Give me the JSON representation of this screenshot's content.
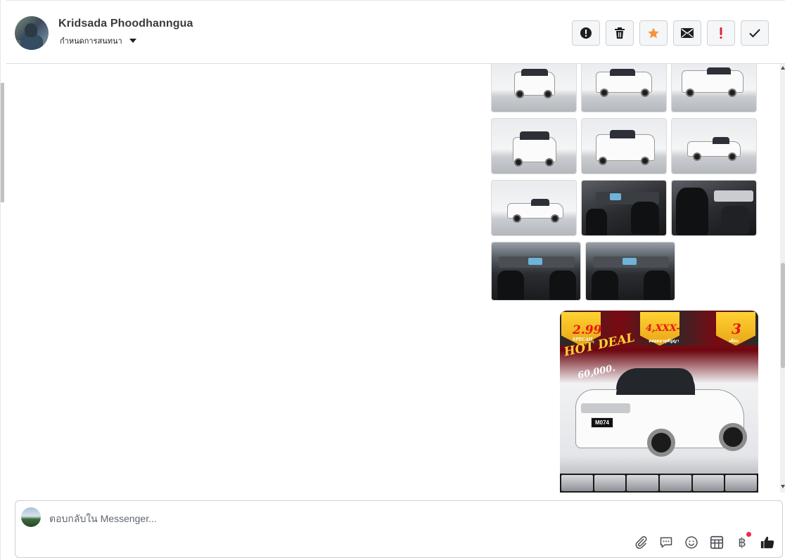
{
  "header": {
    "user_name": "Kridsada Phoodhanngua",
    "subtitle": "กำหนดการสนทนา",
    "actions": [
      {
        "name": "report-icon",
        "color": "#1c1e21"
      },
      {
        "name": "trash-icon",
        "color": "#1c1e21"
      },
      {
        "name": "star-icon",
        "color": "#f7923b"
      },
      {
        "name": "envelope-icon",
        "color": "#1c1e21"
      },
      {
        "name": "exclamation-icon",
        "color": "#e41e3f"
      },
      {
        "name": "check-icon",
        "color": "#1c1e21"
      }
    ]
  },
  "poster": {
    "badge_1": "2.99",
    "badge_1_sub": "SPECAIL",
    "badge_2": "4,XXX-",
    "badge_2_sub": "ตลอดอายุสัญญา",
    "badge_3": "3",
    "badge_3_sub": "เดือน",
    "hot_deal": "HOT DEAL",
    "price": "60,000.",
    "plate": "M074"
  },
  "composer": {
    "placeholder": "ตอบกลับใน Messenger...",
    "tools": [
      "paperclip-icon",
      "chat-bubble-icon",
      "emoji-icon",
      "table-icon",
      "baht-icon",
      "thumbs-up-icon"
    ],
    "baht_symbol": "฿"
  }
}
